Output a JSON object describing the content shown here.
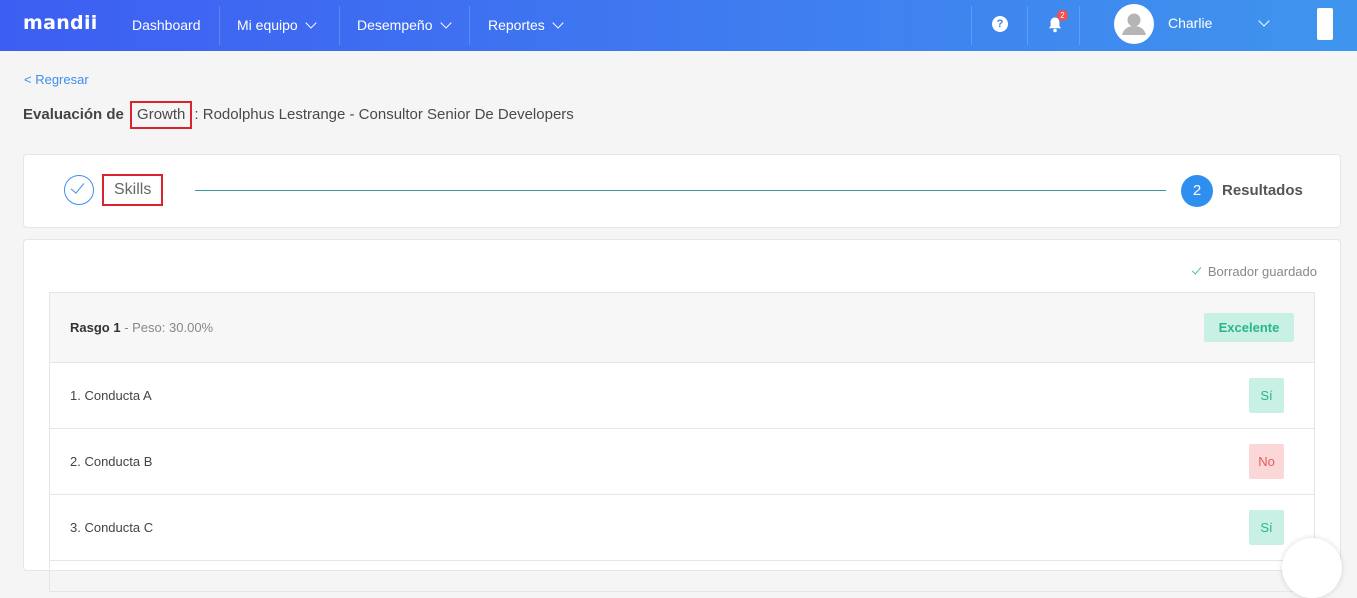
{
  "brand": "mandii",
  "nav": {
    "dashboard": "Dashboard",
    "mi_equipo": "Mi equipo",
    "desempeno": "Desempeño",
    "reportes": "Reportes"
  },
  "help_icon_glyph": "?",
  "notifications_count": "2",
  "user": {
    "name": "Charlie"
  },
  "back_label": "< Regresar",
  "evaluation": {
    "label": "Evaluación de",
    "type": "Growth",
    "separator": ":",
    "subject": "Rodolphus Lestrange - Consultor Senior De Developers"
  },
  "stepper": {
    "step1_label": "Skills",
    "step2_number": "2",
    "step2_label": "Resultados"
  },
  "draft_status": "Borrador guardado",
  "trait": {
    "name": "Rasgo 1",
    "dash": " - ",
    "weight_label": "Peso:",
    "weight_value": "30.00%",
    "rating": "Excelente"
  },
  "behaviors": [
    {
      "label": "1. Conducta A",
      "answer": "Sí"
    },
    {
      "label": "2. Conducta B",
      "answer": "No"
    },
    {
      "label": "3. Conducta C",
      "answer": "Sí"
    }
  ],
  "colors": {
    "accent": "#3f8ef0",
    "yes_bg": "#c9f0e4",
    "yes_fg": "#2bb58b",
    "no_bg": "#fbd7d7",
    "no_fg": "#e55c5c",
    "highlight": "#d9232e"
  },
  "icons": [
    "help-icon",
    "bell-icon",
    "avatar-icon",
    "check-icon",
    "chevron-down-icon"
  ]
}
